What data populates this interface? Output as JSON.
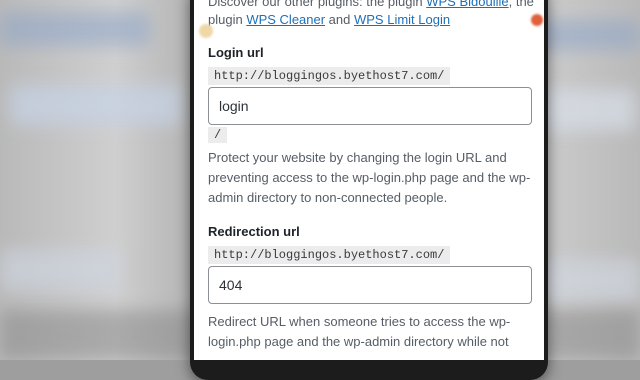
{
  "intro": {
    "text_before": "Discover our other plugins: the plugin ",
    "link1": "WPS Bidouille",
    "text_mid1": ", the plugin ",
    "link2": "WPS Cleaner",
    "text_mid2": " and ",
    "link3": "WPS Limit Login"
  },
  "login": {
    "label": "Login url",
    "prefix": "http://bloggingos.byethost7.com/",
    "value": "login",
    "suffix": "/",
    "description": "Protect your website by changing the login URL and preventing access to the wp-login.php page and the wp-admin directory to non-connected people."
  },
  "redirection": {
    "label": "Redirection url",
    "prefix": "http://bloggingos.byethost7.com/",
    "value": "404",
    "description": "Redirect URL when someone tries to access the wp-login.php page and the wp-admin directory while not"
  }
}
